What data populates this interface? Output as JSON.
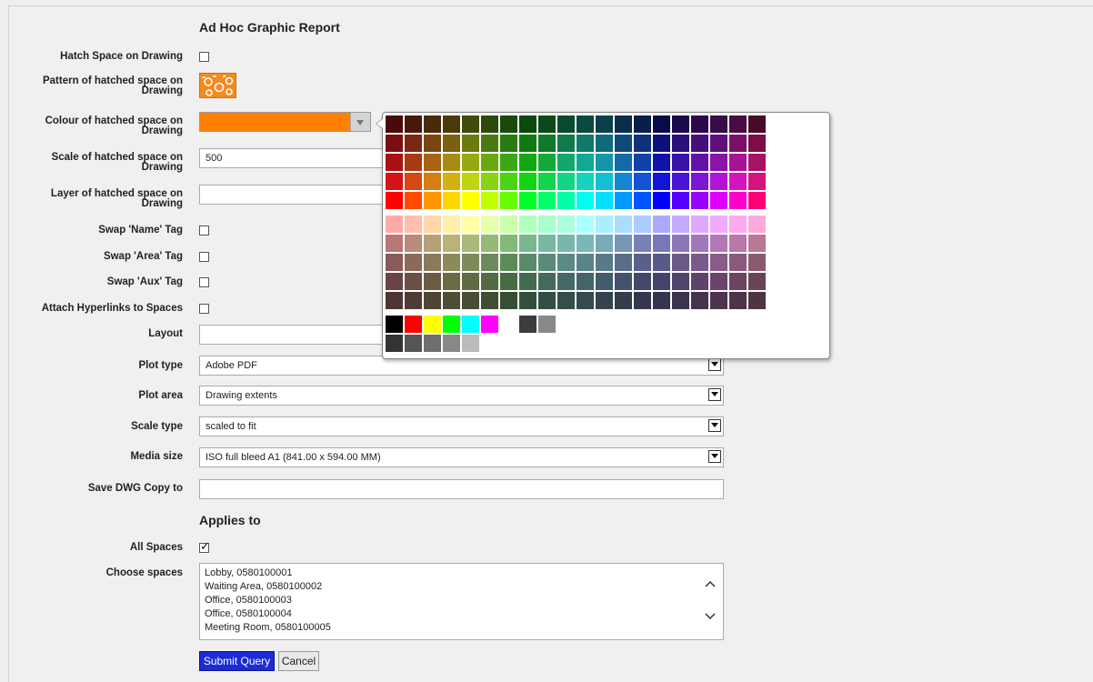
{
  "form": {
    "title": "Ad Hoc Graphic Report",
    "applies_heading": "Applies to",
    "labels": {
      "hatch": "Hatch Space on Drawing",
      "pattern_a": "Pattern of hatched space on",
      "pattern_b": "Drawing",
      "colour_a": "Colour of hatched space on",
      "colour_b": "Drawing",
      "scale_a": "Scale of hatched space on",
      "scale_b": "Drawing",
      "layer_a": "Layer of hatched space on",
      "layer_b": "Drawing",
      "swap_name": "Swap 'Name' Tag",
      "swap_area": "Swap 'Area' Tag",
      "swap_aux": "Swap 'Aux' Tag",
      "hyperlinks": "Attach Hyperlinks to Spaces",
      "layout": "Layout",
      "plot_type": "Plot type",
      "plot_area": "Plot area",
      "scale_type": "Scale type",
      "media_size": "Media size",
      "save_dwg": "Save DWG Copy to",
      "all_spaces": "All Spaces",
      "choose_spaces": "Choose spaces"
    },
    "values": {
      "hatch_checked": false,
      "colour_value": "#ff8000",
      "scale": "500",
      "layer": "",
      "swap_name_checked": false,
      "swap_area_checked": false,
      "swap_aux_checked": false,
      "hyperlinks_checked": false,
      "layout": "",
      "plot_type": "Adobe PDF",
      "plot_area": "Drawing extents",
      "scale_type": "scaled to fit",
      "media_size": "ISO full bleed A1 (841.00 x 594.00 MM)",
      "save_dwg": "",
      "all_spaces_checked": true
    },
    "spaces": [
      "Lobby, 0580100001",
      "Waiting Area, 0580100002",
      "Office, 0580100003",
      "Office, 0580100004",
      "Meeting Room, 0580100005"
    ],
    "buttons": {
      "submit": "Submit Query",
      "cancel": "Cancel"
    }
  },
  "icons": {
    "dropdown": "chevron-down-icon",
    "scroll_up": "chevron-up-icon",
    "scroll_down": "chevron-down-icon",
    "pattern": "hatch-pattern-icon"
  },
  "palette": {
    "hue_rows": [
      [
        "#4a0a0a",
        "#4a180a",
        "#4a2a0a",
        "#4a3a0a",
        "#424a0a",
        "#2e4a0a",
        "#1a4a0a",
        "#0a4a0a",
        "#0a4a1a",
        "#0a4a2e",
        "#0a4a42",
        "#0a404a",
        "#0a2e4a",
        "#0a1e4a",
        "#0a0a4a",
        "#1a0a4a",
        "#2a0a4a",
        "#3a0a4a",
        "#4a0a42",
        "#4a0a2a"
      ],
      [
        "#7a0f0f",
        "#7a280f",
        "#7a450f",
        "#7a600f",
        "#6a7a0f",
        "#4a7a0f",
        "#2a7a0f",
        "#0f7a0f",
        "#0f7a2a",
        "#0f7a4a",
        "#0f7a6a",
        "#0f6a7a",
        "#0f4a7a",
        "#0f307a",
        "#0f0f7a",
        "#2a0f7a",
        "#450f7a",
        "#600f7a",
        "#7a0f6a",
        "#7a0f45"
      ],
      [
        "#a81212",
        "#a83a12",
        "#a86312",
        "#a88c12",
        "#96a812",
        "#6aa812",
        "#3aa812",
        "#12a812",
        "#12a83a",
        "#12a86a",
        "#12a896",
        "#1296a8",
        "#126aa8",
        "#1242a8",
        "#1212a8",
        "#3a12a8",
        "#6312a8",
        "#8c12a8",
        "#a81296",
        "#a81263"
      ],
      [
        "#d41414",
        "#d44a14",
        "#d47e14",
        "#d4b014",
        "#bed414",
        "#86d414",
        "#4ad414",
        "#14d414",
        "#14d44a",
        "#14d486",
        "#14d4be",
        "#14bed4",
        "#1486d4",
        "#1454d4",
        "#1414d4",
        "#4a14d4",
        "#7e14d4",
        "#b014d4",
        "#d414be",
        "#d4147e"
      ],
      [
        "#ff0000",
        "#ff4a00",
        "#ff9500",
        "#ffd700",
        "#ffff00",
        "#bfff00",
        "#66ff00",
        "#00ff2a",
        "#00ff6a",
        "#00ffaa",
        "#00ffee",
        "#00e0ff",
        "#0099ff",
        "#0055ff",
        "#0000ff",
        "#5500ff",
        "#9900ff",
        "#dd00ff",
        "#ff00cc",
        "#ff0077"
      ]
    ],
    "tint_rows": [
      [
        "#ffaaaa",
        "#ffbfaa",
        "#ffd6aa",
        "#fff0aa",
        "#ffffaa",
        "#e6ffaa",
        "#ccffaa",
        "#b3ffbf",
        "#aaffcc",
        "#aaffdd",
        "#aaffff",
        "#aaeeff",
        "#aaddff",
        "#aaccff",
        "#aaaaff",
        "#c4aaff",
        "#ddaaff",
        "#f0aaff",
        "#ffaaee",
        "#ffaadd"
      ],
      [
        "#b87878",
        "#b88c78",
        "#b8a078",
        "#b8b478",
        "#aab878",
        "#96b878",
        "#82b878",
        "#78b88c",
        "#78b8a0",
        "#78b8aa",
        "#78b8b8",
        "#78aab8",
        "#7896b8",
        "#7882b8",
        "#7878b8",
        "#8c78b8",
        "#a078b8",
        "#b478b8",
        "#b878aa",
        "#b87896"
      ],
      [
        "#8a5a5a",
        "#8a6a5a",
        "#8a7a5a",
        "#8a8a5a",
        "#7e8a5a",
        "#6e8a5a",
        "#5e8a5a",
        "#5a8a6a",
        "#5a8a7a",
        "#5a8a84",
        "#5a848a",
        "#5a7a8a",
        "#5a6e8a",
        "#5a608a",
        "#5a5a8a",
        "#6a5a8a",
        "#7a5a8a",
        "#8a5a8a",
        "#8a5a7e",
        "#8a5a6e"
      ],
      [
        "#6a4444",
        "#6a5044",
        "#6a5c44",
        "#6a6a44",
        "#606a44",
        "#546a44",
        "#486a44",
        "#446a50",
        "#446a5c",
        "#446a66",
        "#44666a",
        "#445c6a",
        "#44526a",
        "#44486a",
        "#44446a",
        "#50446a",
        "#5c446a",
        "#6a446a",
        "#6a4460",
        "#6a4454"
      ],
      [
        "#4e3434",
        "#4e3c34",
        "#4e4434",
        "#4e4e34",
        "#484e34",
        "#404e34",
        "#384e34",
        "#344e3c",
        "#344e44",
        "#344e4a",
        "#344a4e",
        "#34444e",
        "#343c4e",
        "#34364e",
        "#34344e",
        "#3c344e",
        "#44344e",
        "#4e344e",
        "#4e3448",
        "#4e3440"
      ]
    ],
    "basic_row1": [
      "#000000",
      "#ff0000",
      "#ffff00",
      "#00ff00",
      "#00ffff",
      "#ff00ff",
      "",
      "#3c3c3c",
      "#888888"
    ],
    "basic_row2": [
      "#333333",
      "#555555",
      "#6e6e6e",
      "#888888",
      "#bbbbbb"
    ]
  }
}
